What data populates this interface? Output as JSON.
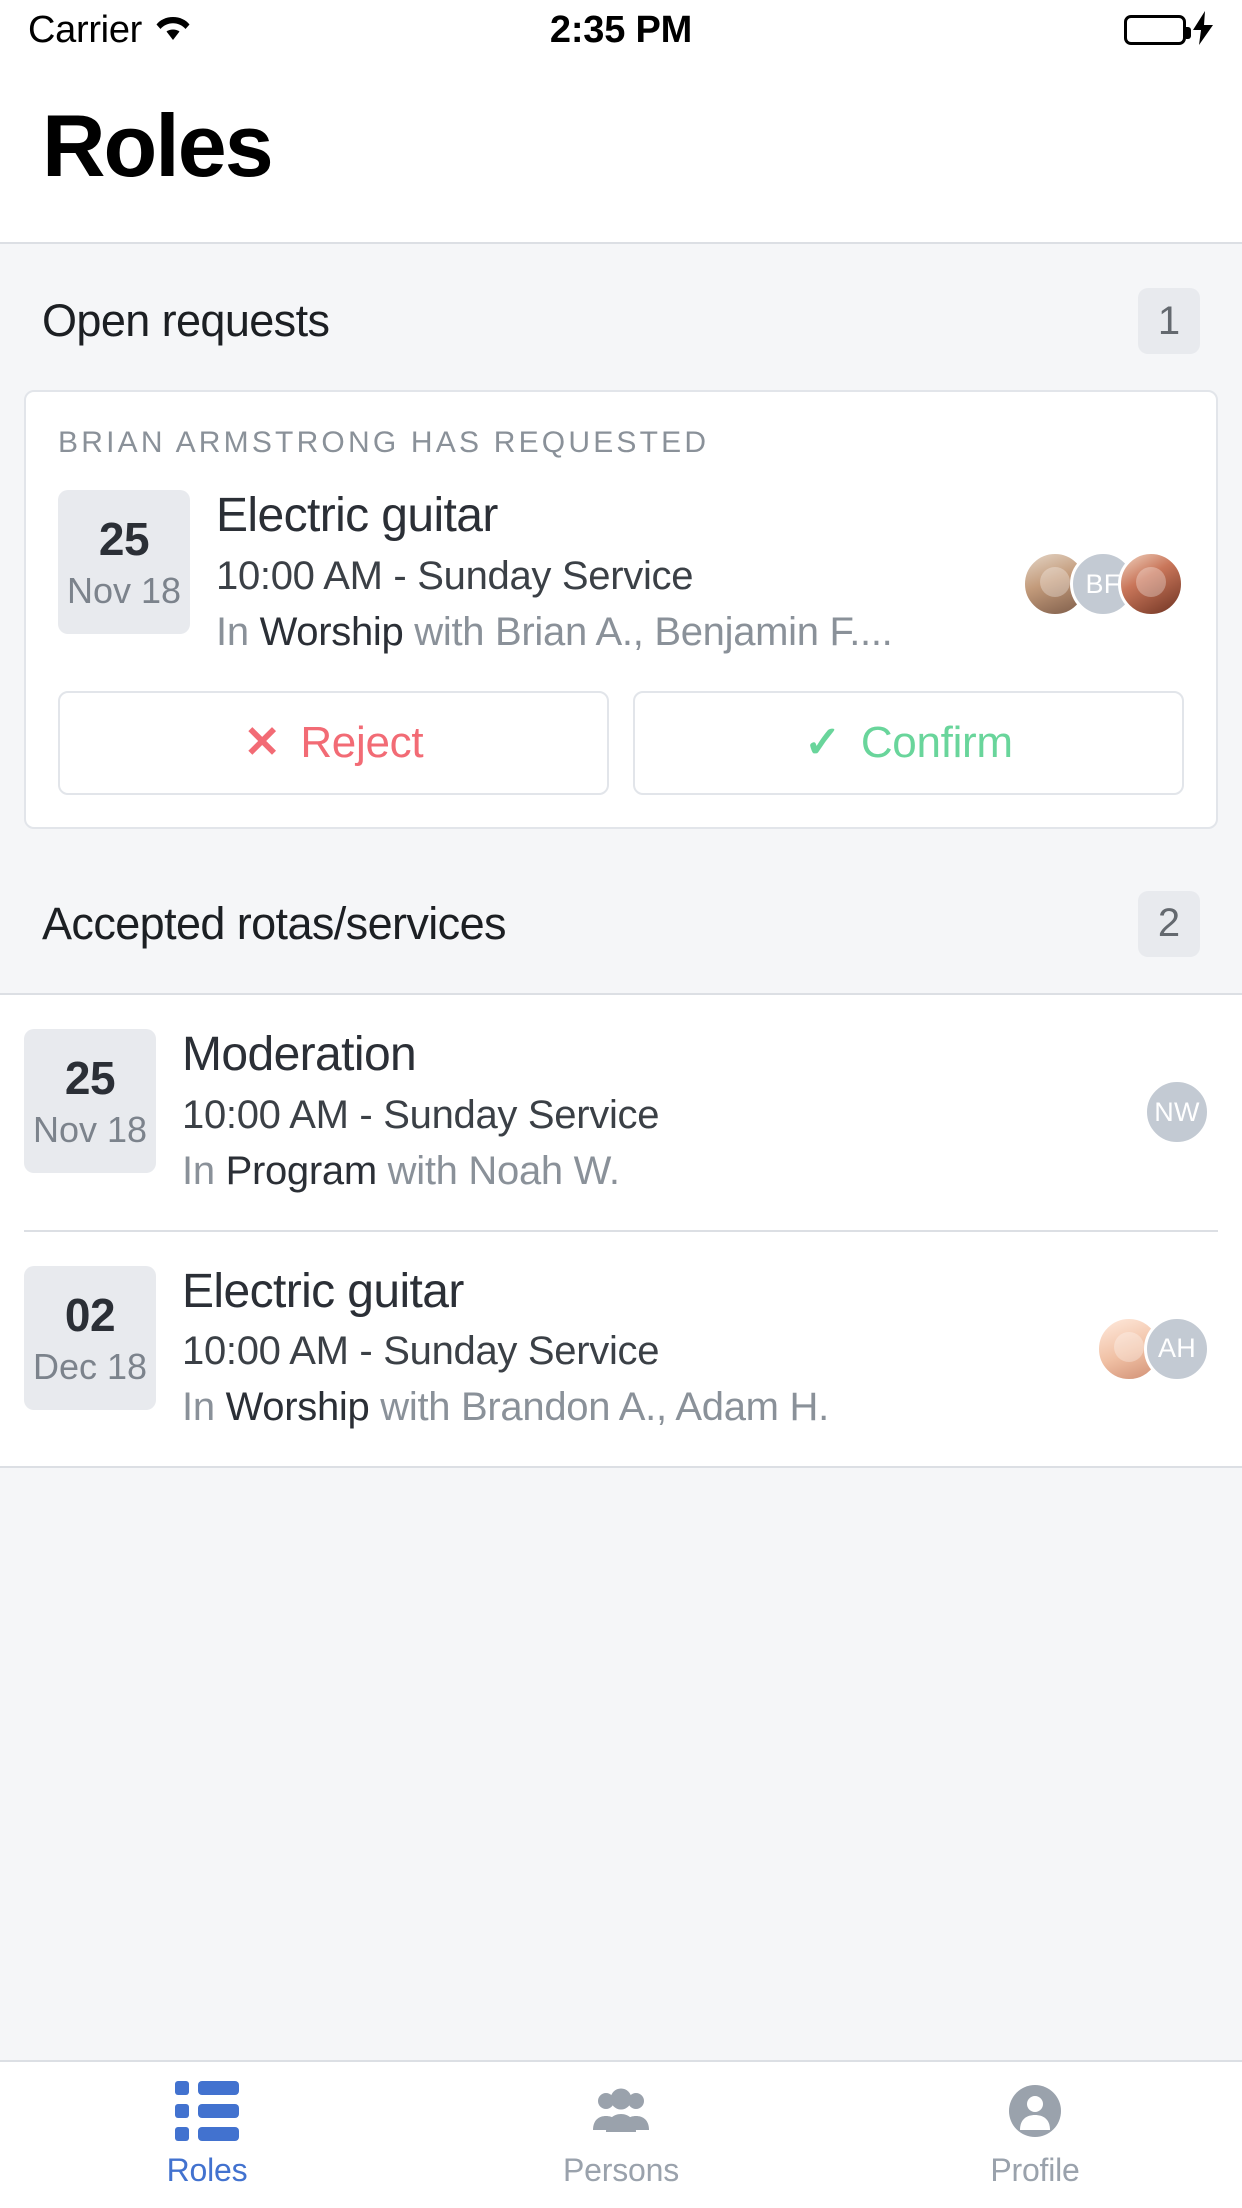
{
  "status_bar": {
    "carrier": "Carrier",
    "time": "2:35 PM",
    "wifi_icon": "wifi-icon",
    "battery_icon": "battery-icon",
    "charging_icon": "charging-bolt-icon",
    "battery_color": "#4CD964"
  },
  "header": {
    "title": "Roles"
  },
  "open_requests": {
    "section_label": "Open requests",
    "count": "1",
    "card": {
      "eyebrow": "Brian Armstrong has requested",
      "date_day": "25",
      "date_month": "Nov 18",
      "role": "Electric guitar",
      "time_service": "10:00 AM - Sunday Service",
      "meta_prefix": "In ",
      "meta_team": "Worship",
      "meta_people": " with Brian A., Benjamin F....",
      "avatars": [
        {
          "type": "photo",
          "initials": ""
        },
        {
          "type": "initials",
          "initials": "BF"
        },
        {
          "type": "photo",
          "initials": ""
        }
      ],
      "reject_label": "Reject",
      "reject_icon": "close-icon",
      "reject_color": "#f26b75",
      "confirm_label": "Confirm",
      "confirm_icon": "check-icon",
      "confirm_color": "#69d59b"
    }
  },
  "accepted": {
    "section_label": "Accepted rotas/services",
    "count": "2",
    "rows": [
      {
        "date_day": "25",
        "date_month": "Nov 18",
        "role": "Moderation",
        "time_service": "10:00 AM - Sunday Service",
        "meta_prefix": "In ",
        "meta_team": "Program",
        "meta_people": " with Noah W.",
        "avatars": [
          {
            "type": "initials",
            "initials": "NW"
          }
        ]
      },
      {
        "date_day": "02",
        "date_month": "Dec 18",
        "role": "Electric guitar",
        "time_service": "10:00 AM - Sunday Service",
        "meta_prefix": "In ",
        "meta_team": "Worship",
        "meta_people": " with Brandon A., Adam H.",
        "avatars": [
          {
            "type": "photo",
            "initials": ""
          },
          {
            "type": "initials",
            "initials": "AH"
          }
        ]
      }
    ]
  },
  "tabbar": {
    "active_color": "#4272cf",
    "inactive_color": "#9aa2ac",
    "tabs": [
      {
        "label": "Roles",
        "icon": "list-icon",
        "active": true
      },
      {
        "label": "Persons",
        "icon": "people-icon",
        "active": false
      },
      {
        "label": "Profile",
        "icon": "person-circle-icon",
        "active": false
      }
    ]
  }
}
